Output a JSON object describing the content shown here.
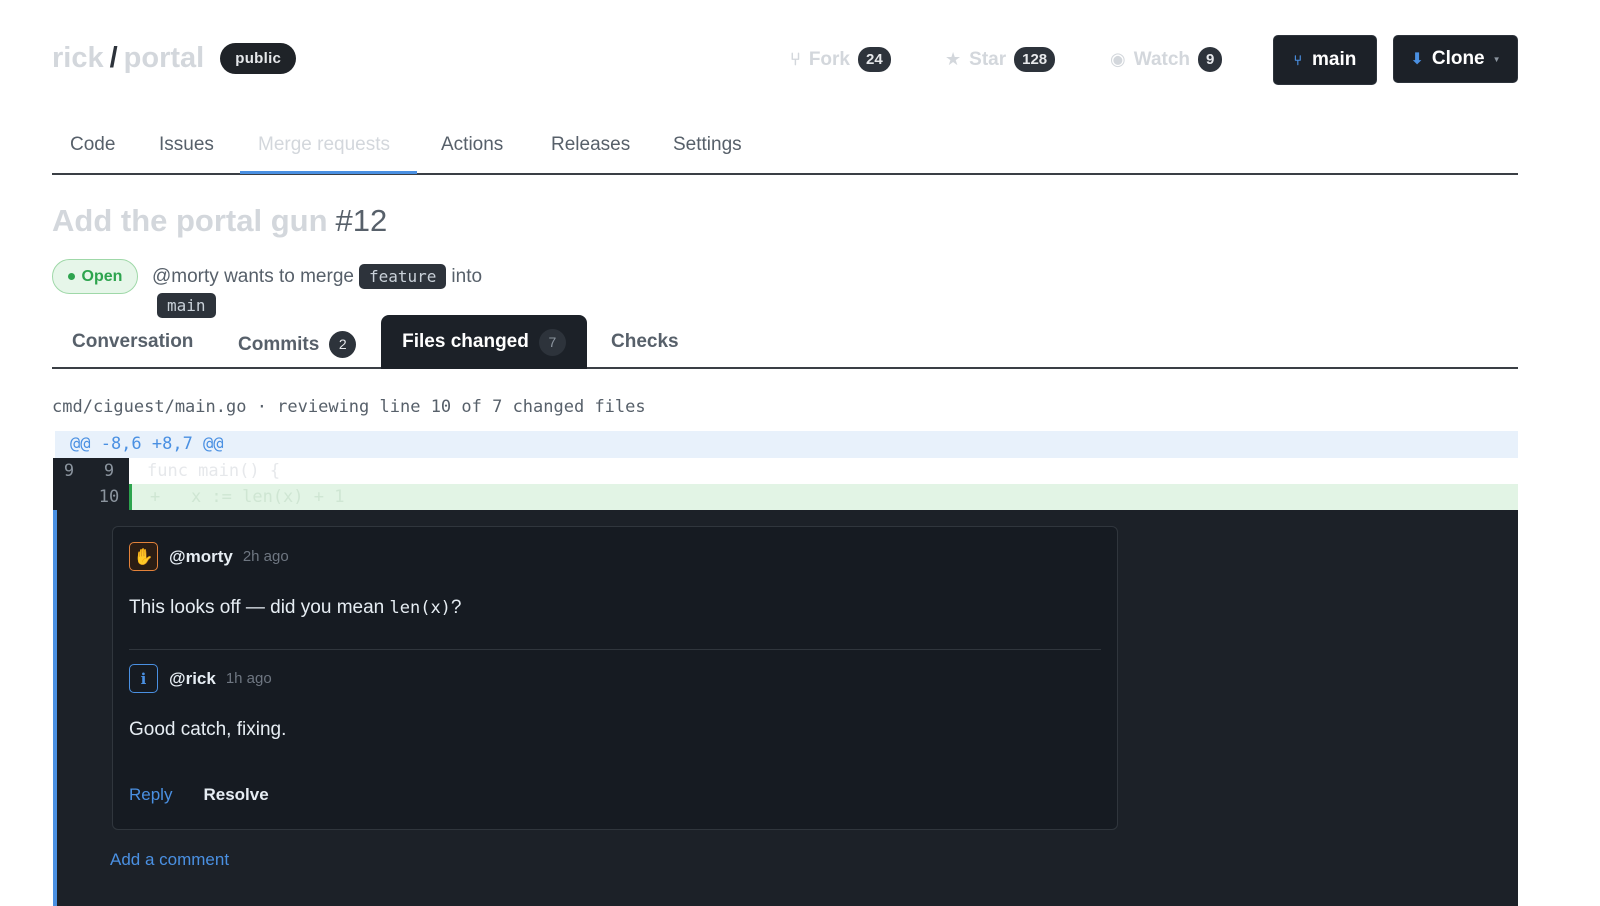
{
  "repo": {
    "owner": "rick",
    "separator": "/",
    "name": "portal",
    "visibility": "public"
  },
  "stats": {
    "fork": {
      "label": "Fork",
      "count": "24",
      "icon": "fork-icon"
    },
    "star": {
      "label": "Star",
      "count": "128",
      "icon": "star-icon"
    },
    "watch": {
      "label": "Watch",
      "count": "9",
      "icon": "eye-icon"
    }
  },
  "actions": {
    "branch_label": "main",
    "clone_label": "Clone"
  },
  "nav": {
    "tabs": [
      "Code",
      "Issues",
      "Merge requests",
      "Actions",
      "Releases",
      "Settings"
    ],
    "active": "Merge requests"
  },
  "mr": {
    "title": "Add the portal gun",
    "number": "#12",
    "status": "Open",
    "author_text": "@morty wants to merge",
    "source_branch": "feature",
    "into_text": "into",
    "target_branch": "main"
  },
  "pr_tabs": {
    "conversation": "Conversation",
    "commits": "Commits",
    "commits_count": "2",
    "files": "Files changed",
    "files_count": "7",
    "checks": "Checks"
  },
  "file": {
    "header": "cmd/ciguest/main.go · reviewing line 10 of 7 changed files"
  },
  "diff": {
    "hunk": "@@ -8,6 +8,7 @@",
    "context_line": {
      "old": "9",
      "new": "9",
      "code": "func main() {"
    },
    "added_line": {
      "old": "",
      "new": "10",
      "code": "+   x := len(x) + 1"
    }
  },
  "thread": {
    "comments": [
      {
        "author": "@morty",
        "time": "2h ago",
        "text_before": "This looks off — did you mean ",
        "code": "len(x)",
        "text_after": "?",
        "avatar": "hand-icon"
      },
      {
        "author": "@rick",
        "time": "1h ago",
        "text": "Good catch, fixing.",
        "avatar": "info-icon"
      }
    ],
    "reply_label": "Reply",
    "resolve_label": "Resolve",
    "add_comment_label": "Add a comment"
  },
  "colors": {
    "accent": "#4a90e2",
    "open_green": "#2da44e",
    "dark_surface": "#1c2128"
  }
}
